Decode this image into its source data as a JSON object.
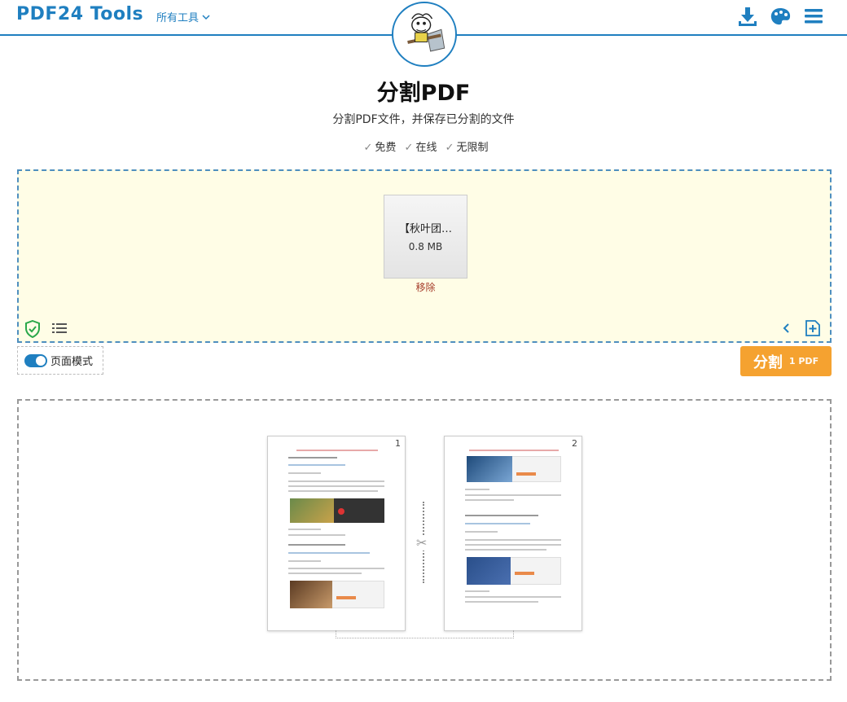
{
  "header": {
    "brand": "PDF24 Tools",
    "all_tools_label": "所有工具",
    "icons": [
      "download-icon",
      "palette-icon",
      "menu-icon"
    ],
    "accent": "#1f7fc0"
  },
  "main": {
    "title": "分割PDF",
    "subtitle": "分割PDF文件，并保存已分割的文件",
    "badges": [
      "免费",
      "在线",
      "无限制"
    ]
  },
  "file": {
    "name": "【秋叶团…",
    "size": "0.8 MB",
    "remove_label": "移除"
  },
  "controls": {
    "mode_label": "页面模式",
    "split_label": "分割",
    "split_count": "1 PDF",
    "split_color": "#f5a230"
  },
  "preview": {
    "pages": [
      {
        "number": "1"
      },
      {
        "number": "2"
      }
    ]
  }
}
